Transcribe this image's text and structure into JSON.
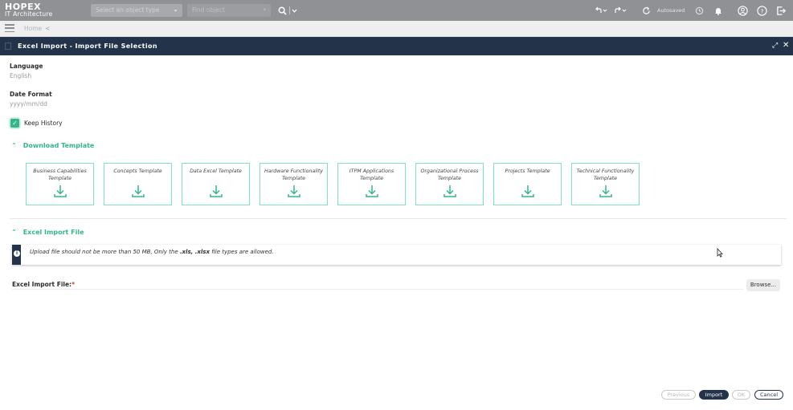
{
  "app": {
    "brand": "HOPEX",
    "subtitle": "IT Architecture"
  },
  "topbar": {
    "object_type_placeholder": "Select an object type",
    "find_object_placeholder": "Find object",
    "autosaved": "Autosaved",
    "icons": [
      "search-icon",
      "undo-icon",
      "redo-icon",
      "refresh-icon",
      "history-icon",
      "bell-icon",
      "user-icon",
      "help-icon",
      "logout-icon"
    ]
  },
  "breadcrumb": {
    "home": "Home"
  },
  "dialog": {
    "title": "Excel Import - Import File Selection",
    "language_label": "Language",
    "language_value": "English",
    "date_format_label": "Date Format",
    "date_format_placeholder": "yyyy/mm/dd",
    "keep_history_label": "Keep History",
    "keep_history_checked": true,
    "download_section_title": "Download Template",
    "templates": [
      {
        "label": "Business Capabilities Template"
      },
      {
        "label": "Concepts Template"
      },
      {
        "label": "Data Excel Template"
      },
      {
        "label": "Hardware Functionality Template"
      },
      {
        "label": "ITPM Applications Template"
      },
      {
        "label": "Organizational Process Template"
      },
      {
        "label": "Projects Template"
      },
      {
        "label": "Technical Functionality Template"
      }
    ],
    "import_section_title": "Excel Import File",
    "info_message_pre": "Upload file should not be more than 50 MB, Only the ",
    "info_ext1": ".xls",
    "info_sep": ", ",
    "info_ext2": ".xlsx",
    "info_message_post": " file types are allowed.",
    "file_label": "Excel Import File:",
    "required_mark": "*",
    "browse_label": "Browse..."
  },
  "footer": {
    "previous": "Previous",
    "import": "Import",
    "ok": "OK",
    "cancel": "Cancel"
  },
  "colors": {
    "accent": "#34b58c",
    "header": "#23344a",
    "topbar": "#8f9194",
    "template_border": "#7ee3c4"
  }
}
